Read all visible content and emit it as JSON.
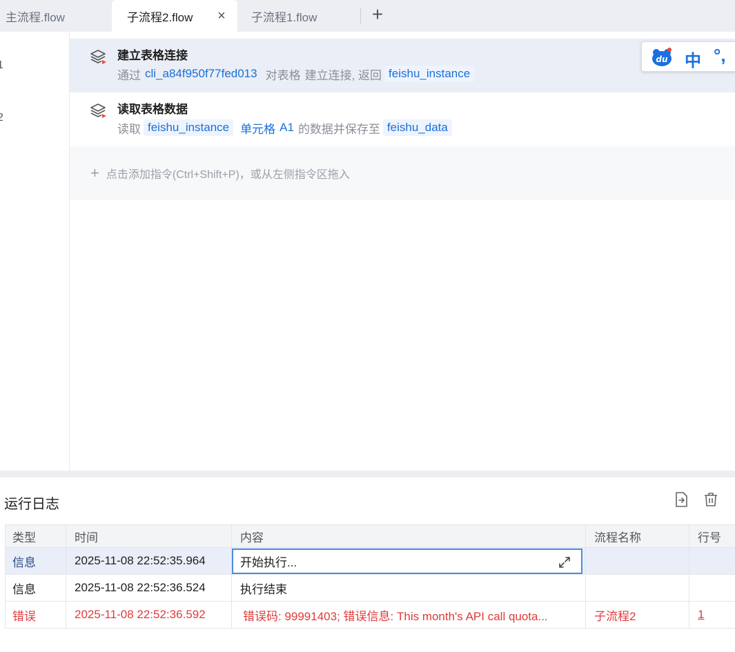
{
  "tabs": [
    {
      "label": "主流程.flow"
    },
    {
      "label": "子流程2.flow",
      "active": true
    },
    {
      "label": "子流程1.flow"
    }
  ],
  "tab_close": "×",
  "tab_add": "+",
  "gutter": {
    "line1": "1",
    "line2": "2"
  },
  "commands": [
    {
      "title": "建立表格连接",
      "desc": {
        "p1": "通过",
        "app_id": "cli_a84f950f77fed013",
        "p2": "对表格",
        "p3": "建立连接, 返回",
        "ret": "feishu_instance"
      }
    },
    {
      "title": "读取表格数据",
      "desc": {
        "p1": "读取",
        "src": "feishu_instance",
        "cell_label": "单元格",
        "cell": "A1",
        "p2": "的数据并保存至",
        "dest": "feishu_data"
      }
    }
  ],
  "add_hint": "点击添加指令(Ctrl+Shift+P)，或从左侧指令区拖入",
  "add_plus": "+",
  "ime": {
    "zh": "中",
    "punc": "°,"
  },
  "log": {
    "title": "运行日志",
    "columns": [
      "类型",
      "时间",
      "内容",
      "流程名称",
      "行号"
    ],
    "rows": [
      {
        "type": "信息",
        "time": "2025-11-08 22:52:35.964",
        "content": "开始执行...",
        "flow": "",
        "line": ""
      },
      {
        "type": "信息",
        "time": "2025-11-08 22:52:36.524",
        "content": "执行结束",
        "flow": "",
        "line": ""
      },
      {
        "type": "错误",
        "time": "2025-11-08 22:52:36.592",
        "content": "错误码: 99991403; 错误信息: This month's API call quota...",
        "flow": "子流程2",
        "line": "1"
      }
    ]
  },
  "colors": {
    "accent": "#1a6fd8",
    "error": "#e03a3a",
    "selected_row": "#e9eef8",
    "tab_bar": "#eceef2"
  },
  "icons": [
    "close-icon",
    "plus-icon",
    "layers-icon",
    "du-logo-icon",
    "export-icon",
    "trash-icon",
    "expand-icon"
  ]
}
